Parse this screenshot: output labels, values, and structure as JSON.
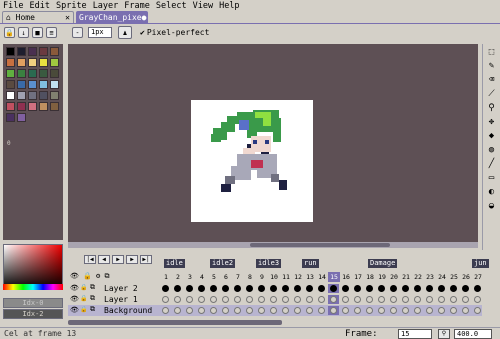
{
  "menu": [
    "File",
    "Edit",
    "Sprite",
    "Layer",
    "Frame",
    "Select",
    "View",
    "Help"
  ],
  "tabs": {
    "home": "Home",
    "sprite": "GrayChan_pixe"
  },
  "toolbar": {
    "brush_size": "1px",
    "pixel_perfect": "Pixel-perfect"
  },
  "palette": {
    "colors": [
      "#000000",
      "#1e1e2e",
      "#4a3050",
      "#6b3a40",
      "#8a5a3a",
      "#c87040",
      "#e0a060",
      "#f0d080",
      "#e8e040",
      "#a0c840",
      "#60b040",
      "#3a8040",
      "#2a6a50",
      "#3a5a40",
      "#4a4a3a",
      "#5a4a40",
      "#3a6aa8",
      "#5a90d0",
      "#80c0e0",
      "#c0e0f0",
      "#ffffff",
      "#a0a0b0",
      "#707080",
      "#505060",
      "#808070",
      "#c05060",
      "#903050",
      "#d07080",
      "#c09060",
      "#806040",
      "#4a3060",
      "#8060a0"
    ],
    "index_label": "0"
  },
  "color": {
    "fg_label": "Idx-0",
    "bg_label": "Idx-2"
  },
  "timeline": {
    "tags": [
      {
        "name": "idle"
      },
      {
        "name": "idle2"
      },
      {
        "name": "idle3"
      },
      {
        "name": "run"
      },
      {
        "name": "Damage"
      },
      {
        "name": "jun"
      }
    ],
    "frames": [
      "1",
      "2",
      "3",
      "4",
      "5",
      "6",
      "7",
      "8",
      "9",
      "10",
      "11",
      "12",
      "13",
      "14",
      "15",
      "16",
      "17",
      "18",
      "19",
      "20",
      "21",
      "22",
      "23",
      "24",
      "25",
      "26",
      "27"
    ],
    "current_frame_index": 14,
    "layers": [
      {
        "name": "Layer 2"
      },
      {
        "name": "Layer 1"
      },
      {
        "name": "Background"
      }
    ]
  },
  "status": {
    "text": "Cel at frame 13",
    "frame_label": "Frame:",
    "frame_value": "15",
    "zoom_value": "400.0"
  },
  "colors": {
    "accent": "#7a6fb0",
    "canvas_bg": "#5e5055",
    "ui_bg": "#d4d0c8"
  }
}
